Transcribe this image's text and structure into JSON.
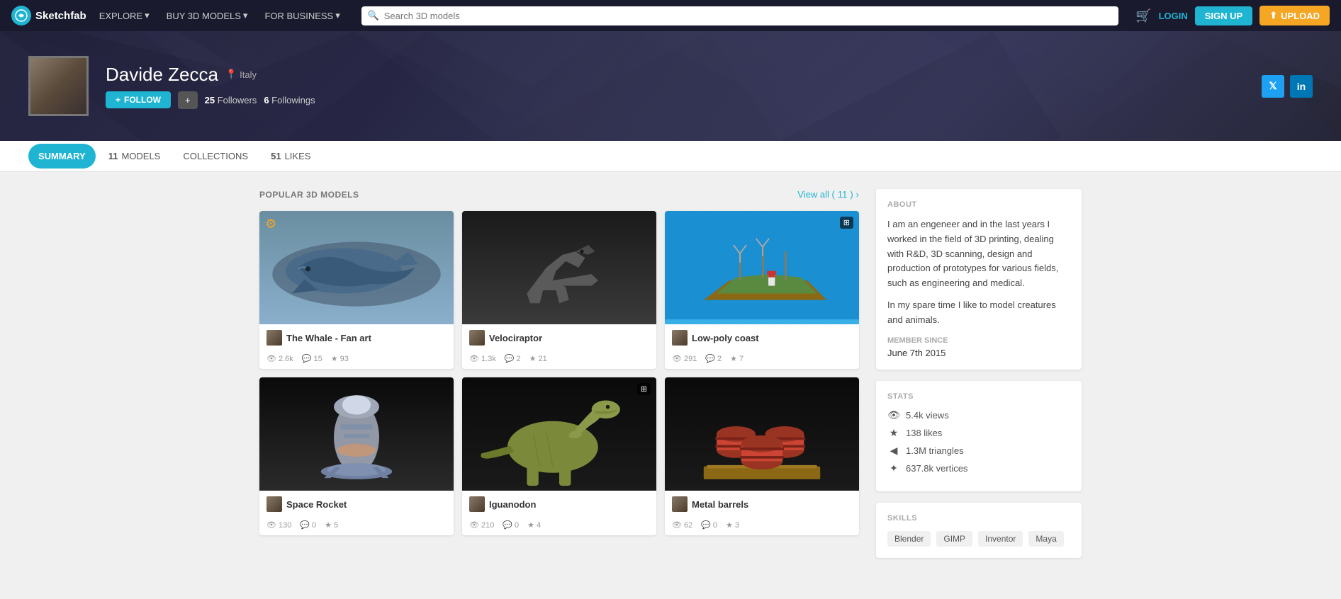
{
  "nav": {
    "logo": "Sketchfab",
    "links": [
      {
        "label": "EXPLORE",
        "hasDropdown": true
      },
      {
        "label": "BUY 3D MODELS",
        "hasDropdown": true
      },
      {
        "label": "FOR BUSINESS",
        "hasDropdown": true
      }
    ],
    "search_placeholder": "Search 3D models",
    "login_label": "LOGIN",
    "signup_label": "SIGN UP",
    "upload_label": "UPLOAD"
  },
  "hero": {
    "name": "Davide Zecca",
    "location": "Italy",
    "follow_label": "FOLLOW",
    "followers": "25",
    "followers_label": "Followers",
    "followings": "6",
    "followings_label": "Followings"
  },
  "tabs": [
    {
      "label": "SUMMARY",
      "count": null,
      "active": true
    },
    {
      "label": "MODELS",
      "count": "11",
      "active": false
    },
    {
      "label": "COLLECTIONS",
      "count": null,
      "active": false
    },
    {
      "label": "LIKES",
      "count": "51",
      "active": false
    }
  ],
  "section": {
    "popular_title": "POPULAR 3D MODELS",
    "view_all_label": "View all (11)",
    "view_all_count": "11"
  },
  "models": [
    {
      "name": "The Whale - Fan art",
      "views": "2.6k",
      "comments": "15",
      "likes": "93",
      "thumb_class": "thumb-whale",
      "has_gear": true,
      "has_badge": false
    },
    {
      "name": "Velociraptor",
      "views": "1.3k",
      "comments": "2",
      "likes": "21",
      "thumb_class": "thumb-raptor",
      "has_gear": false,
      "has_badge": false
    },
    {
      "name": "Low-poly coast",
      "views": "291",
      "comments": "2",
      "likes": "7",
      "thumb_class": "thumb-coast",
      "has_gear": false,
      "has_badge": true
    },
    {
      "name": "Space Rocket",
      "views": "130",
      "comments": "0",
      "likes": "5",
      "thumb_class": "thumb-rocket",
      "has_gear": false,
      "has_badge": false
    },
    {
      "name": "Iguanodon",
      "views": "210",
      "comments": "0",
      "likes": "4",
      "thumb_class": "thumb-dino",
      "has_gear": false,
      "has_badge": true
    },
    {
      "name": "Metal barrels",
      "views": "62",
      "comments": "0",
      "likes": "3",
      "thumb_class": "thumb-barrels",
      "has_gear": false,
      "has_badge": false
    }
  ],
  "about": {
    "title": "ABOUT",
    "text1": "I am an engeneer and in the last years I worked in the field of 3D printing, dealing with R&D, 3D scanning, design and production of prototypes for various fields, such as engineering and medical.",
    "text2": "In my spare time I like to model creatures and animals.",
    "member_since_label": "MEMBER SINCE",
    "member_since_date": "June 7th 2015"
  },
  "stats": {
    "title": "STATS",
    "views": "5.4k views",
    "likes": "138 likes",
    "triangles": "1.3M triangles",
    "vertices": "637.8k vertices"
  },
  "skills": {
    "title": "SKILLS",
    "items": [
      "Blender",
      "GIMP",
      "Inventor",
      "Maya"
    ]
  }
}
